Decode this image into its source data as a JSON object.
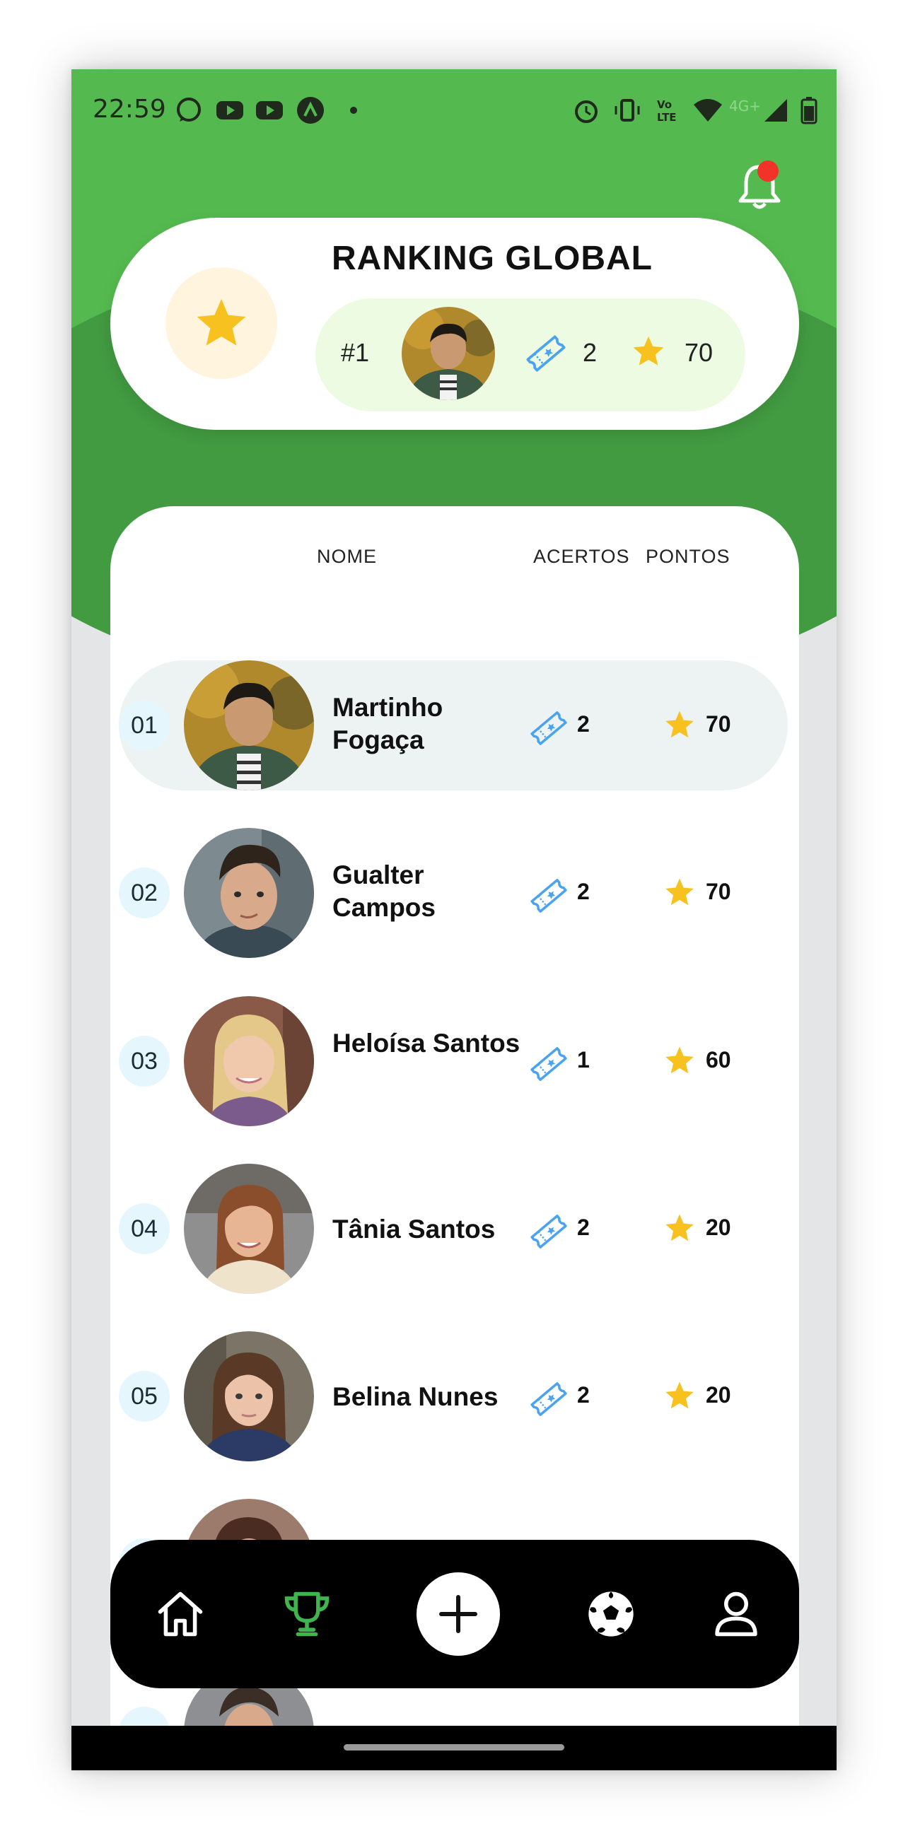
{
  "status_bar": {
    "time": "22:59",
    "network": "4G+"
  },
  "header": {
    "title": "RANKING GLOBAL"
  },
  "my_rank": {
    "position": "#1",
    "hits": "2",
    "points": "70"
  },
  "columns": {
    "name": "NOME",
    "hits": "ACERTOS",
    "points": "PONTOS"
  },
  "ranking": [
    {
      "pos": "01",
      "name": "Martinho Fogaça",
      "hits": "2",
      "points": "70"
    },
    {
      "pos": "02",
      "name": "Gualter Campos",
      "hits": "2",
      "points": "70"
    },
    {
      "pos": "03",
      "name": "Heloísa Santos",
      "hits": "1",
      "points": "60"
    },
    {
      "pos": "04",
      "name": "Tânia Santos",
      "hits": "2",
      "points": "20"
    },
    {
      "pos": "05",
      "name": "Belina Nunes",
      "hits": "2",
      "points": "20"
    }
  ],
  "nav": [
    "home-icon",
    "trophy-icon",
    "add-icon",
    "soccer-ball-icon",
    "profile-icon"
  ],
  "colors": {
    "primary_green": "#54ba4f",
    "dark_green": "#429a41",
    "star": "#f7c21f",
    "ticket": "#4aa3f0",
    "active_nav": "#3fb44f"
  }
}
